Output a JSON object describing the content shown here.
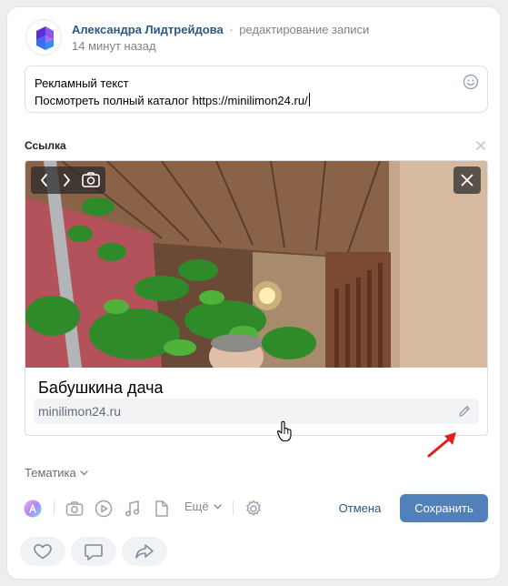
{
  "post": {
    "author_name": "Александра Лидтрейдова",
    "separator": "·",
    "action": "редактирование записи",
    "time": "14 минут назад"
  },
  "editor": {
    "line1": "Рекламный текст",
    "line2": "Посмотреть полный каталог https://minilimon24.ru/"
  },
  "attachment": {
    "section_label": "Ссылка",
    "title": "Бабушкина дача",
    "url": "minilimon24.ru"
  },
  "topic_label": "Тематика",
  "toolbar": {
    "more_label": "Ещё",
    "cancel_label": "Отмена",
    "save_label": "Сохранить"
  },
  "icons": {
    "avatar": "brand-logo-icon",
    "emoji": "emoji-icon",
    "close": "close-icon",
    "photo_prev": "chevron-left-icon",
    "photo_next": "chevron-right-icon",
    "photo_camera": "camera-icon",
    "edit": "pencil-icon",
    "toolbar": [
      "ai-icon",
      "camera-icon",
      "video-icon",
      "music-icon",
      "document-icon",
      "gear-icon"
    ],
    "reactions": [
      "like-icon",
      "comment-icon",
      "share-icon"
    ]
  },
  "colors": {
    "accent": "#5181b8",
    "link": "#2a5885",
    "arrow": "#e02020"
  }
}
